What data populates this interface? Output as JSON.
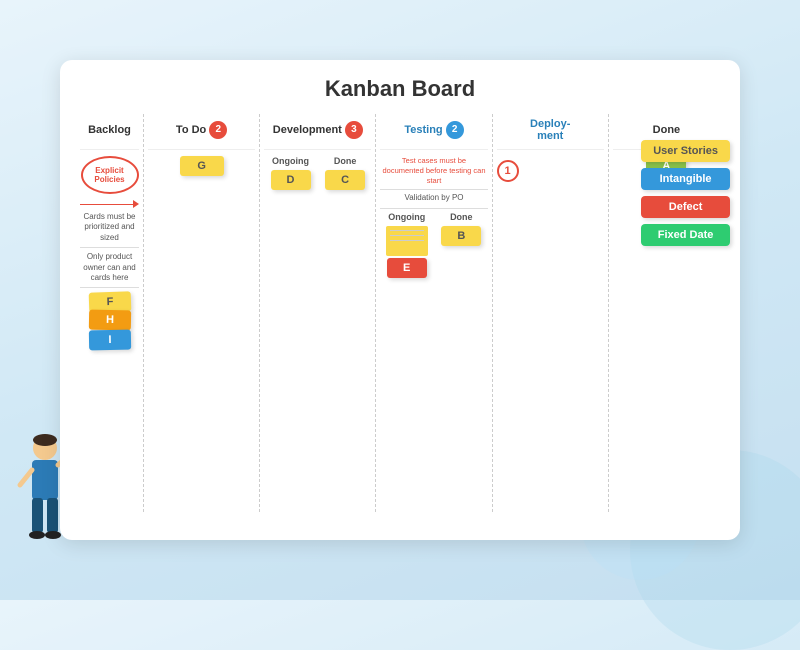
{
  "board": {
    "title": "Kanban Board",
    "columns": [
      {
        "id": "backlog",
        "label": "Backlog",
        "badge": null,
        "policy_label": "Explicit Policies",
        "policy1": "Cards must be prioritized and sized",
        "policy2": "Only product owner can and cards here",
        "cards": [
          {
            "label": "F",
            "color": "yellow"
          },
          {
            "label": "H",
            "color": "orange"
          },
          {
            "label": "I",
            "color": "blue"
          }
        ]
      },
      {
        "id": "todo",
        "label": "To Do",
        "badge": "2",
        "badge_color": "red",
        "cards": [
          {
            "label": "G",
            "color": "yellow"
          }
        ]
      },
      {
        "id": "development",
        "label": "Development",
        "badge": "3",
        "badge_color": "red",
        "sub_columns": [
          {
            "label": "Ongoing",
            "cards": [
              {
                "label": "D",
                "color": "yellow"
              }
            ]
          },
          {
            "label": "Done",
            "cards": [
              {
                "label": "C",
                "color": "yellow"
              }
            ]
          }
        ]
      },
      {
        "id": "testing",
        "label": "Testing",
        "badge": "2",
        "badge_color": "blue",
        "policy": "Test cases must be documented before testing can start",
        "sub_columns": [
          {
            "label": "Ongoing",
            "cards": [
              {
                "label": "E",
                "color": "red"
              }
            ]
          },
          {
            "label": "Done",
            "cards": [
              {
                "label": "B",
                "color": "yellow"
              }
            ]
          }
        ]
      },
      {
        "id": "deployment",
        "label": "Deployment",
        "badge_outline": "1",
        "cards": []
      },
      {
        "id": "done",
        "label": "Done",
        "cards": [
          {
            "label": "A",
            "color": "green"
          }
        ]
      }
    ]
  },
  "legend": [
    {
      "label": "User Stories",
      "color": "yellow"
    },
    {
      "label": "Intangible",
      "color": "blue"
    },
    {
      "label": "Defect",
      "color": "red"
    },
    {
      "label": "Fixed Date",
      "color": "green"
    }
  ],
  "validation_text": "Validation by PO"
}
